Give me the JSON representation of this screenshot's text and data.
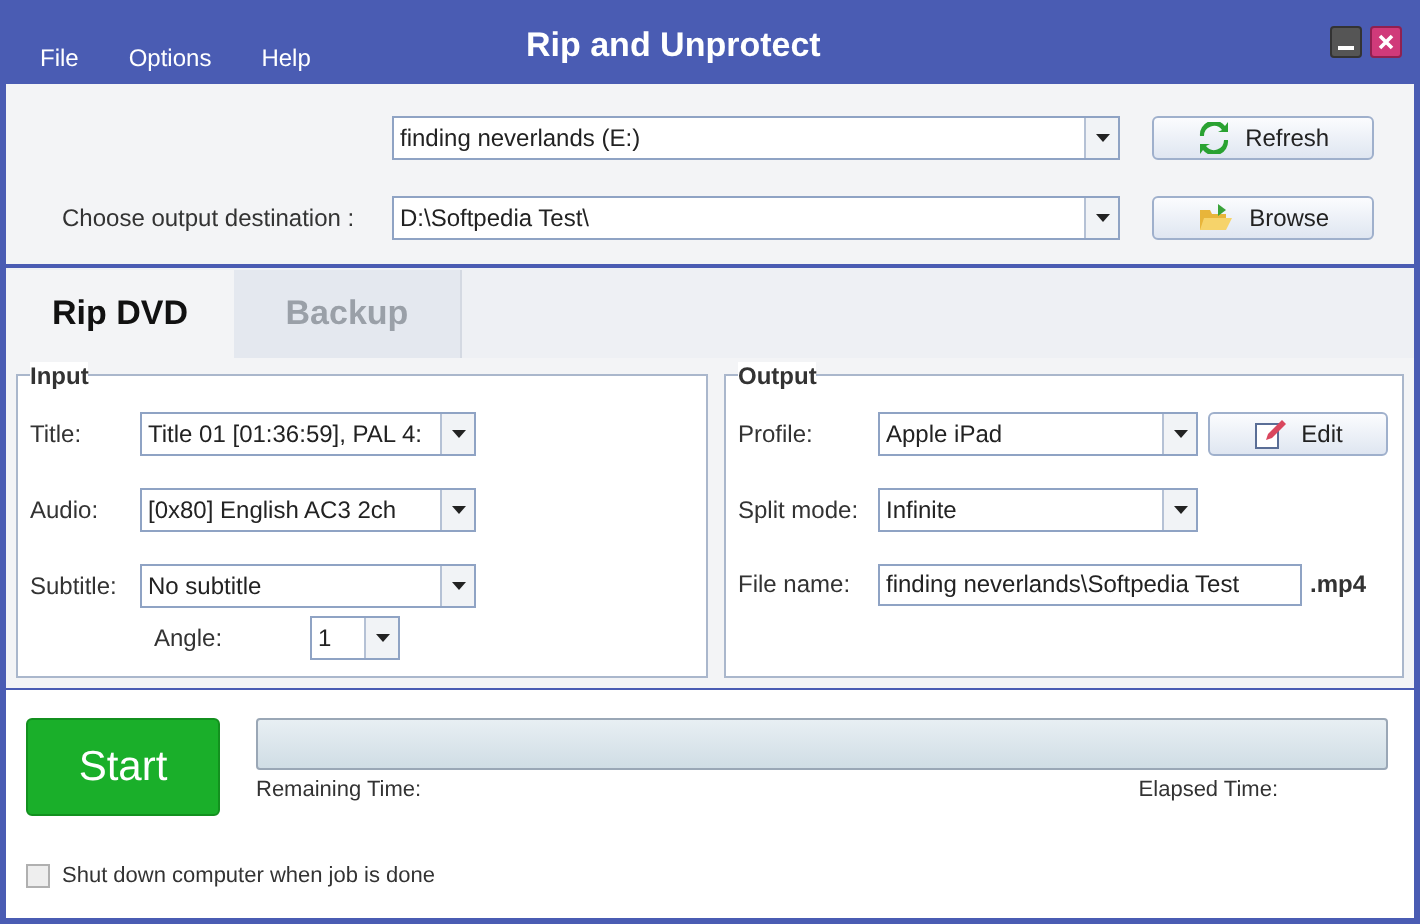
{
  "window": {
    "title": "Rip and Unprotect"
  },
  "menu": [
    "File",
    "Options",
    "Help"
  ],
  "source": {
    "value": "finding neverlands (E:)",
    "button": "Refresh"
  },
  "destination": {
    "label": "Choose output destination :",
    "value": "D:\\Softpedia Test\\",
    "button": "Browse"
  },
  "tabs": [
    {
      "label": "Rip DVD",
      "selected": true
    },
    {
      "label": "Backup",
      "selected": false
    }
  ],
  "input": {
    "legend": "Input",
    "fields": [
      {
        "label": "Title:",
        "value": "Title 01 [01:36:59], PAL 4:"
      },
      {
        "label": "Audio:",
        "value": "[0x80] English AC3 2ch"
      },
      {
        "label": "Subtitle:",
        "value": "No subtitle"
      }
    ],
    "angle": {
      "label": "Angle:",
      "value": "1"
    }
  },
  "output": {
    "legend": "Output",
    "profile": {
      "label": "Profile:",
      "value": "Apple iPad",
      "button": "Edit"
    },
    "split": {
      "label": "Split mode:",
      "value": "Infinite"
    },
    "file": {
      "label": "File name:",
      "value": "finding neverlands\\Softpedia Test",
      "ext": ".mp4"
    }
  },
  "start_button": "Start",
  "progress": {
    "remaining": "Remaining Time:",
    "elapsed": "Elapsed Time:"
  },
  "shutdown": {
    "label": "Shut down computer when job is done",
    "checked": false
  }
}
